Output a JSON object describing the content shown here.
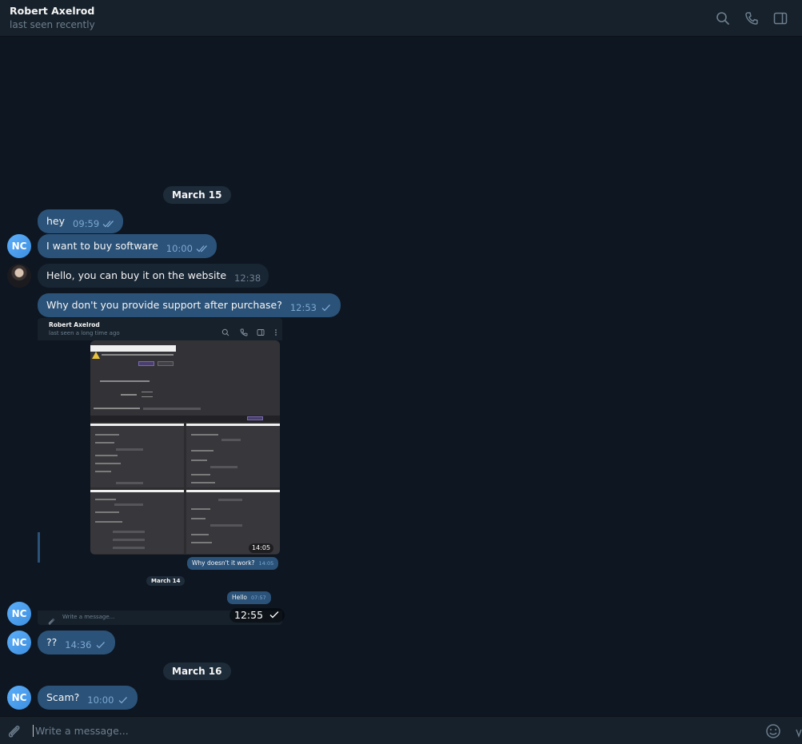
{
  "header": {
    "contact_name": "Robert Axelrod",
    "status": "last seen recently",
    "icons": [
      "search-icon",
      "phone-icon",
      "sidebar-toggle-icon"
    ]
  },
  "dates": {
    "march15": "March 15",
    "march16": "March 16"
  },
  "messages": [
    {
      "id": "m1",
      "direction": "out",
      "text": "hey",
      "time": "09:59",
      "status": "read"
    },
    {
      "id": "m2",
      "direction": "out",
      "text": "I want to buy software",
      "time": "10:00",
      "status": "read",
      "avatar": "NC"
    },
    {
      "id": "m3",
      "direction": "in",
      "text": "Hello, you can buy it on the website",
      "time": "12:38"
    },
    {
      "id": "m4",
      "direction": "out",
      "text": "Why don't you provide support after purchase?",
      "time": "12:53",
      "status": "sent"
    },
    {
      "id": "m5",
      "direction": "out",
      "type": "image",
      "time": "12:55",
      "status": "sent",
      "avatar": "NC"
    },
    {
      "id": "m6",
      "direction": "out",
      "text": "??",
      "time": "14:36",
      "status": "sent",
      "avatar": "NC"
    },
    {
      "id": "m7",
      "direction": "out",
      "text": "Scam?",
      "time": "10:00",
      "status": "sent",
      "avatar": "NC"
    }
  ],
  "avatars": {
    "nc": "NC"
  },
  "screenshot": {
    "contact_name": "Robert Axelrod",
    "status": "last seen a long time ago",
    "image_time": "14:05",
    "msg1": {
      "text": "Why doesn't it work?",
      "time": "14:05"
    },
    "date": "March 14",
    "msg2": {
      "text": "Hello",
      "time": "07:57"
    },
    "input_placeholder": "Write a message...",
    "dialog": {
      "warning_text": "Data is not valid. Are you sure, that you want to continue?",
      "ok": "Ok",
      "cancel": "Cancel",
      "additional_fingerprints_label": "Enable additional fingerprints",
      "additional_fingerprints_value": "On",
      "enable_label": "Enable Quit",
      "enable_option": "Enable",
      "disable_option": "Disable",
      "minutes_label": "How many minutes to wait for SMS",
      "restart": "Restart"
    }
  },
  "composer": {
    "placeholder": "Write a message..."
  },
  "colors": {
    "background": "#0e1621",
    "header": "#17212b",
    "outgoing_bubble": "#2b5278",
    "incoming_bubble": "#182533",
    "accent": "#5caffa"
  }
}
